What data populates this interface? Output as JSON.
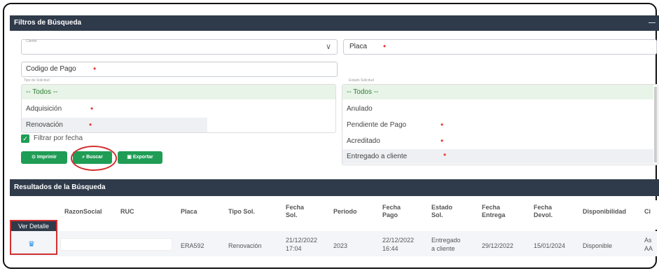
{
  "filters": {
    "header": "Filtros de Búsqueda",
    "collapse": "—",
    "cliente_label": "Cliente",
    "placa_placeholder": "Placa",
    "codigo_pago_placeholder": "Codigo de Pago",
    "tipo_solicitud_label": "Tipo de Solicitud",
    "estado_solicitud_label": "Estado Solicitud",
    "tipo_options": [
      "-- Todos --",
      "Adquisición",
      "Renovación"
    ],
    "estado_options": [
      "-- Todos --",
      "Anulado",
      "Pendiente de Pago",
      "Acreditado",
      "Entregado a cliente"
    ],
    "filtrar_fecha": "Filtrar por fecha",
    "buttons": {
      "imprimir": "Imprimir",
      "buscar": "Buscar",
      "exportar": "Exportar"
    }
  },
  "results": {
    "header": "Resultados de la Búsqueda",
    "ver_detalle": "Ver Detalle",
    "columns": [
      "RazonSocial",
      "RUC",
      "Placa",
      "Tipo Sol.",
      "Fecha Sol.",
      "Periodo",
      "Fecha Pago",
      "Estado Sol.",
      "Fecha Entrega",
      "Fecha Devol.",
      "Disponibilidad",
      "Ci"
    ],
    "row": {
      "placa": "ERA592",
      "tipo": "Renovación",
      "fecha_sol_1": "21/12/2022",
      "fecha_sol_2": "17:04",
      "periodo": "2023",
      "fecha_pago_1": "22/12/2022",
      "fecha_pago_2": "16:44",
      "estado_1": "Entregado",
      "estado_2": "a cliente",
      "fecha_entrega": "29/12/2022",
      "fecha_devol": "15/01/2024",
      "disponibilidad": "Disponible",
      "ci_1": "As",
      "ci_2": "AA"
    }
  },
  "colors": {
    "header_bg": "#2f3a4a",
    "button_green": "#1f9d55",
    "highlight_red": "#d32f2f",
    "selected_bg": "#e8f4e8"
  }
}
